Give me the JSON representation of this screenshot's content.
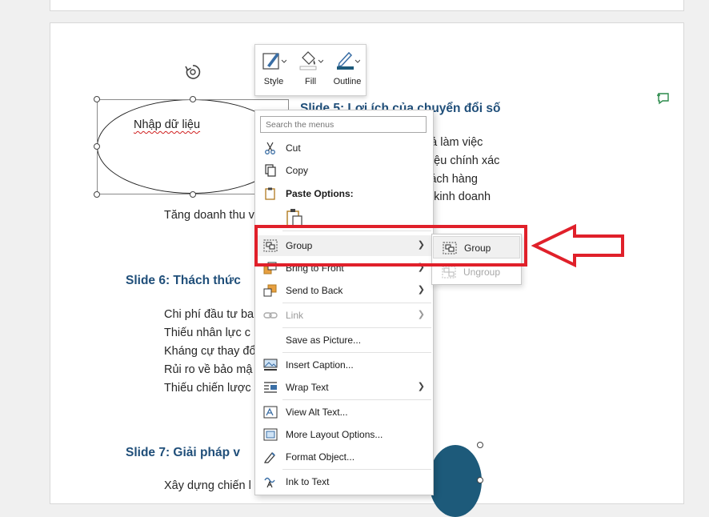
{
  "document": {
    "slide5_heading": "Slide 5: Lợi ích của chuyển đổi số",
    "slide5_lines": [
      "quả làm việc",
      "ữ liệu chính xác",
      "khách hàng",
      "nh kinh doanh"
    ],
    "tang_doanh_thu": "Tăng doanh thu v",
    "slide6_heading": "Slide 6: Thách thức",
    "slide6_lines": [
      "Chi phí đầu tư ba",
      "Thiếu nhân lực c",
      "Kháng cự thay đổ",
      "Rủi ro về bảo mậ",
      "Thiếu chiến lược"
    ],
    "slide7_heading": "Slide 7: Giải pháp v",
    "slide7_line": "Xây dựng chiến l"
  },
  "shape": {
    "text": "Nhập dữ liệu"
  },
  "mini_toolbar": {
    "style_label": "Style",
    "fill_label": "Fill",
    "outline_label": "Outline"
  },
  "context_menu": {
    "search_placeholder": "Search the menus",
    "cut": "Cut",
    "copy": "Copy",
    "paste_options": "Paste Options:",
    "group": "Group",
    "bring_to_front": "Bring to Front",
    "send_to_back": "Send to Back",
    "link": "Link",
    "save_as_picture": "Save as Picture...",
    "insert_caption": "Insert Caption...",
    "wrap_text": "Wrap Text",
    "view_alt_text": "View Alt Text...",
    "more_layout_options": "More Layout Options...",
    "format_object": "Format Object...",
    "ink_to_text": "Ink to Text"
  },
  "submenu": {
    "group": "Group",
    "ungroup": "Ungroup"
  },
  "colors": {
    "heading": "#1f4e79",
    "annotation_red": "#e0202a",
    "outline_blue": "#1d5a7a"
  }
}
